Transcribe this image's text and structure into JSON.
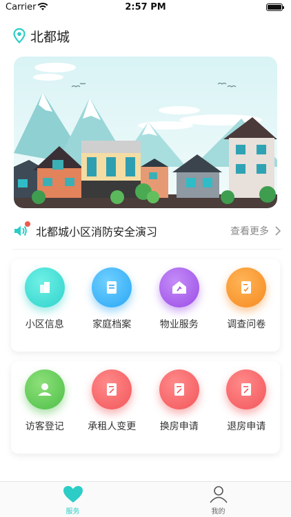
{
  "status_bar": {
    "carrier": "Carrier",
    "time": "2:57 PM"
  },
  "location": {
    "name": "北都城",
    "icon": "location-pin-icon"
  },
  "notice": {
    "text": "北都城小区消防安全演习",
    "more": "查看更多",
    "icon": "speaker-icon"
  },
  "services_row1": [
    {
      "label": "小区信息",
      "icon": "building-icon",
      "color": "#2fd3cc"
    },
    {
      "label": "家庭档案",
      "icon": "document-icon",
      "color": "#2aa6f5"
    },
    {
      "label": "物业服务",
      "icon": "house-repair-icon",
      "color": "#9a4de6"
    },
    {
      "label": "调查问卷",
      "icon": "survey-icon",
      "color": "#f58a1f"
    }
  ],
  "services_row2": [
    {
      "label": "访客登记",
      "icon": "visitor-icon",
      "color": "#4cbf47"
    },
    {
      "label": "承租人变更",
      "icon": "form-icon",
      "color": "#f2565a"
    },
    {
      "label": "换房申请",
      "icon": "form-icon",
      "color": "#f2565a"
    },
    {
      "label": "退房申请",
      "icon": "form-icon",
      "color": "#f2565a"
    }
  ],
  "tabbar": [
    {
      "label": "服务",
      "icon": "heart-icon",
      "active": true
    },
    {
      "label": "我的",
      "icon": "person-icon",
      "active": false
    }
  ]
}
